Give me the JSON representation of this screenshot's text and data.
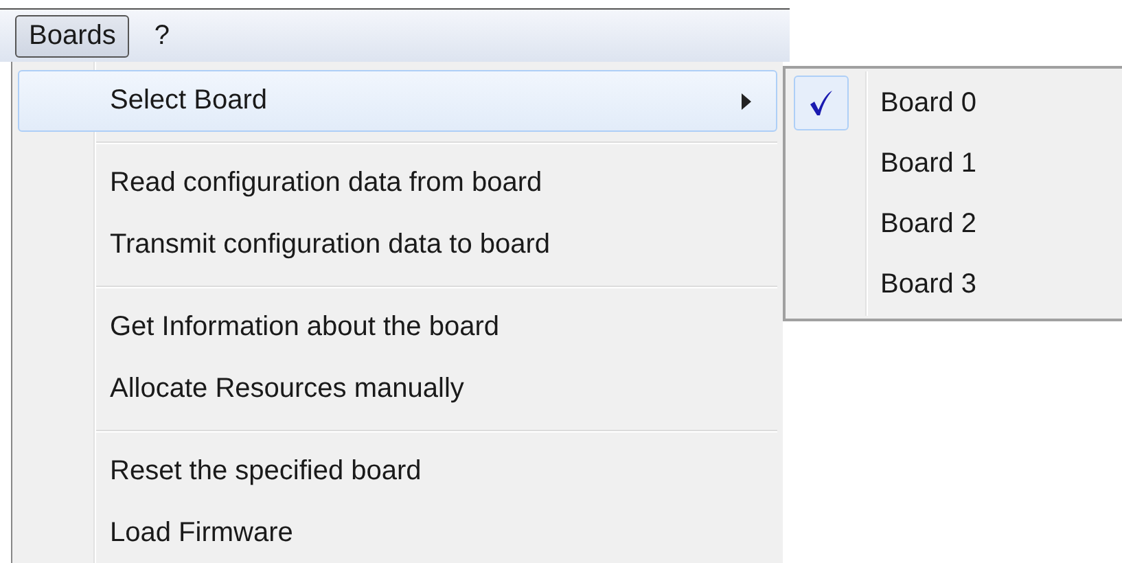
{
  "menu_bar": [
    {
      "label": "Boards",
      "selected": true
    },
    {
      "label": "?",
      "selected": false
    }
  ],
  "menu": [
    {
      "kind": "item",
      "label": "Select Board",
      "selected": true,
      "has_submenu": true
    },
    {
      "kind": "separator"
    },
    {
      "kind": "item",
      "label": "Read configuration data from board",
      "selected": false,
      "has_submenu": false
    },
    {
      "kind": "item",
      "label": "Transmit configuration data to board",
      "selected": false,
      "has_submenu": false
    },
    {
      "kind": "separator"
    },
    {
      "kind": "item",
      "label": "Get Information about the board",
      "selected": false,
      "has_submenu": false
    },
    {
      "kind": "item",
      "label": "Allocate Resources manually",
      "selected": false,
      "has_submenu": false
    },
    {
      "kind": "separator"
    },
    {
      "kind": "item",
      "label": "Reset the specified board",
      "selected": false,
      "has_submenu": false
    },
    {
      "kind": "item",
      "label": "Load Firmware",
      "selected": false,
      "has_submenu": false
    }
  ],
  "submenu": [
    {
      "label": "Board 0",
      "checked": true
    },
    {
      "label": "Board 1",
      "checked": false
    },
    {
      "label": "Board 2",
      "checked": false
    },
    {
      "label": "Board 3",
      "checked": false
    }
  ]
}
